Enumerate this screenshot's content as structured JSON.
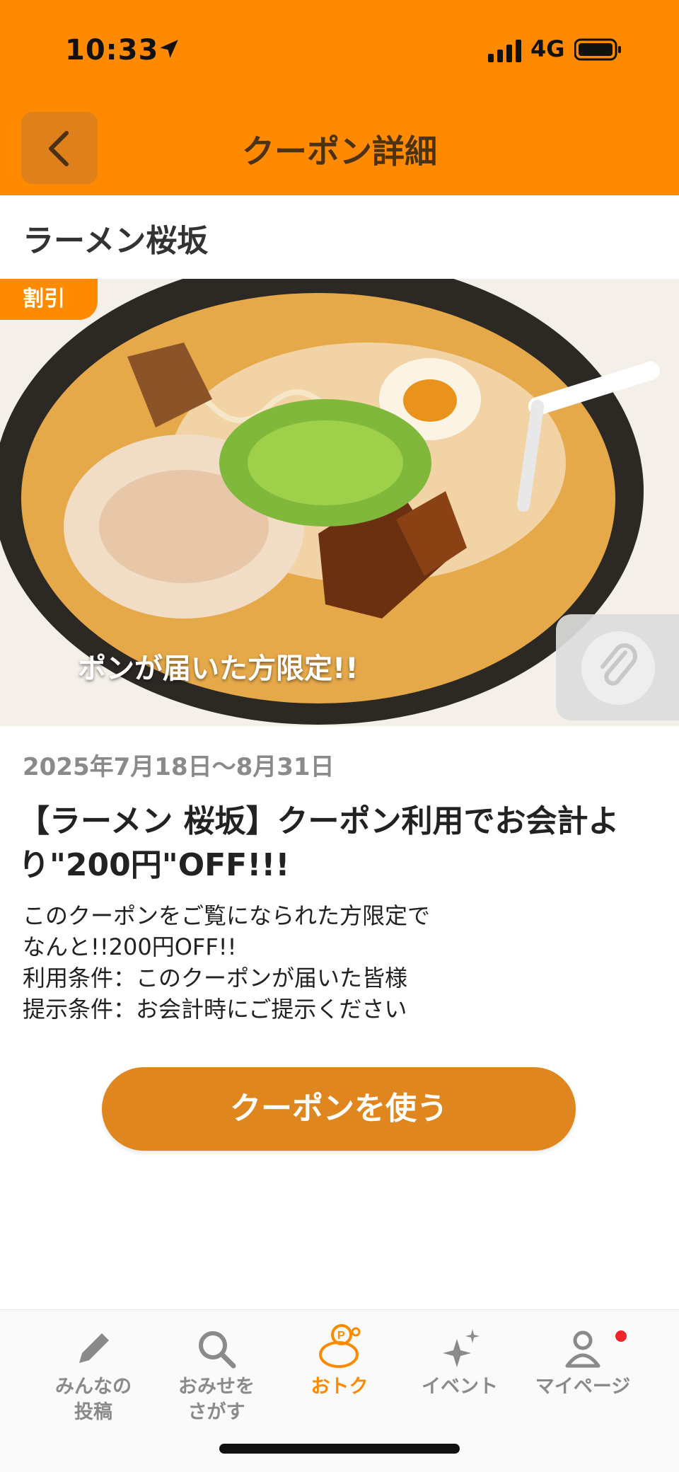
{
  "status_bar": {
    "time": "10:33",
    "network": "4G"
  },
  "header": {
    "title": "クーポン詳細"
  },
  "shop": {
    "name": "ラーメン桜坂"
  },
  "hero": {
    "badge": "割引",
    "overlay_text": "ポンが届いた方限定!!"
  },
  "coupon": {
    "date_range": "2025年7月18日〜8月31日",
    "title": "【ラーメン 桜坂】クーポン利用でお会計より\"200円\"OFF!!!",
    "description": [
      "このクーポンをご覧になられた方限定で",
      "なんと!!200円OFF!!",
      "利用条件：このクーポンが届いた皆様",
      "提示条件：お会計時にご提示ください"
    ],
    "use_button": "クーポンを使う"
  },
  "tabs": [
    {
      "label_line1": "みんなの",
      "label_line2": "投稿",
      "icon": "pencil-icon"
    },
    {
      "label_line1": "おみせを",
      "label_line2": "さがす",
      "icon": "search-icon"
    },
    {
      "label_line1": "おトク",
      "label_line2": "",
      "icon": "piggy-bank-icon"
    },
    {
      "label_line1": "イベント",
      "label_line2": "",
      "icon": "sparkle-icon"
    },
    {
      "label_line1": "マイページ",
      "label_line2": "",
      "icon": "person-icon"
    }
  ],
  "colors": {
    "accent": "#ff8a00",
    "button": "#e0861f",
    "notify": "#f0262a"
  }
}
